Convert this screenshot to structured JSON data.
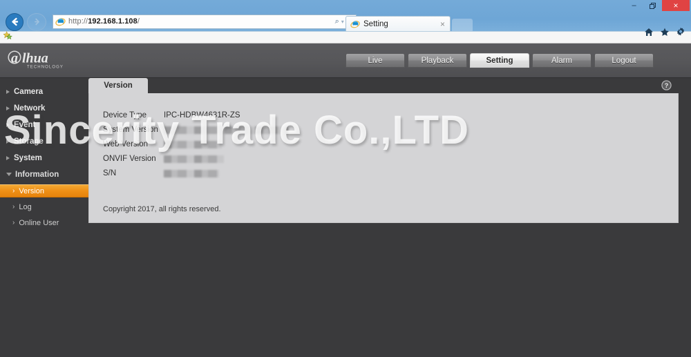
{
  "browser": {
    "window_controls": {
      "minimize": "–",
      "restore": "❐",
      "close": "×"
    },
    "nav": {
      "back_icon": "←",
      "forward_icon": "→",
      "back_name": "back-button",
      "forward_name": "forward-button"
    },
    "address": {
      "url_scheme": "http://",
      "url_host": "192.168.1.108",
      "url_path": "/",
      "url_full": "http://192.168.1.108/",
      "search_icon": "⌕",
      "dropdown_icon": "▾",
      "refresh_icon": "↻"
    },
    "tab": {
      "title": "Setting",
      "close_icon": "×"
    },
    "toolbar_icons": {
      "home": "home-icon",
      "favorites": "star-icon",
      "tools": "gear-icon"
    }
  },
  "app": {
    "brand": {
      "name": "alhua",
      "tagline": "TECHNOLOGY"
    },
    "main_nav": [
      {
        "label": "Live",
        "active": false
      },
      {
        "label": "Playback",
        "active": false
      },
      {
        "label": "Setting",
        "active": true
      },
      {
        "label": "Alarm",
        "active": false
      },
      {
        "label": "Logout",
        "active": false
      }
    ],
    "sidebar": {
      "items": [
        {
          "label": "Camera",
          "expanded": false
        },
        {
          "label": "Network",
          "expanded": false
        },
        {
          "label": "Event",
          "expanded": false
        },
        {
          "label": "Storage",
          "expanded": false
        },
        {
          "label": "System",
          "expanded": false
        },
        {
          "label": "Information",
          "expanded": true
        }
      ],
      "sub_items": [
        {
          "label": "Version",
          "active": true
        },
        {
          "label": "Log",
          "active": false
        },
        {
          "label": "Online User",
          "active": false
        }
      ]
    },
    "panel": {
      "tab_label": "Version",
      "help_icon": "?",
      "rows": [
        {
          "label": "Device Type",
          "value": "IPC-HDBW4631R-ZS",
          "redacted": false,
          "redacted_width": 0
        },
        {
          "label": "System Version",
          "value": "",
          "redacted": true,
          "redacted_width": 180
        },
        {
          "label": "Web Version",
          "value": "",
          "redacted": true,
          "redacted_width": 84
        },
        {
          "label": "ONVIF Version",
          "value": "",
          "redacted": true,
          "redacted_width": 87
        },
        {
          "label": "S/N",
          "value": "",
          "redacted": true,
          "redacted_width": 80
        }
      ],
      "copyright": "Copyright 2017, all rights reserved."
    }
  },
  "watermark": {
    "text": "Sincerity Trade Co.,LTD"
  },
  "colors": {
    "accent_orange": "#ef8f16",
    "app_dark": "#3a3a3c",
    "panel_gray": "#d4d4d6",
    "browser_blue": "#74aad8",
    "close_red": "#e04343"
  }
}
